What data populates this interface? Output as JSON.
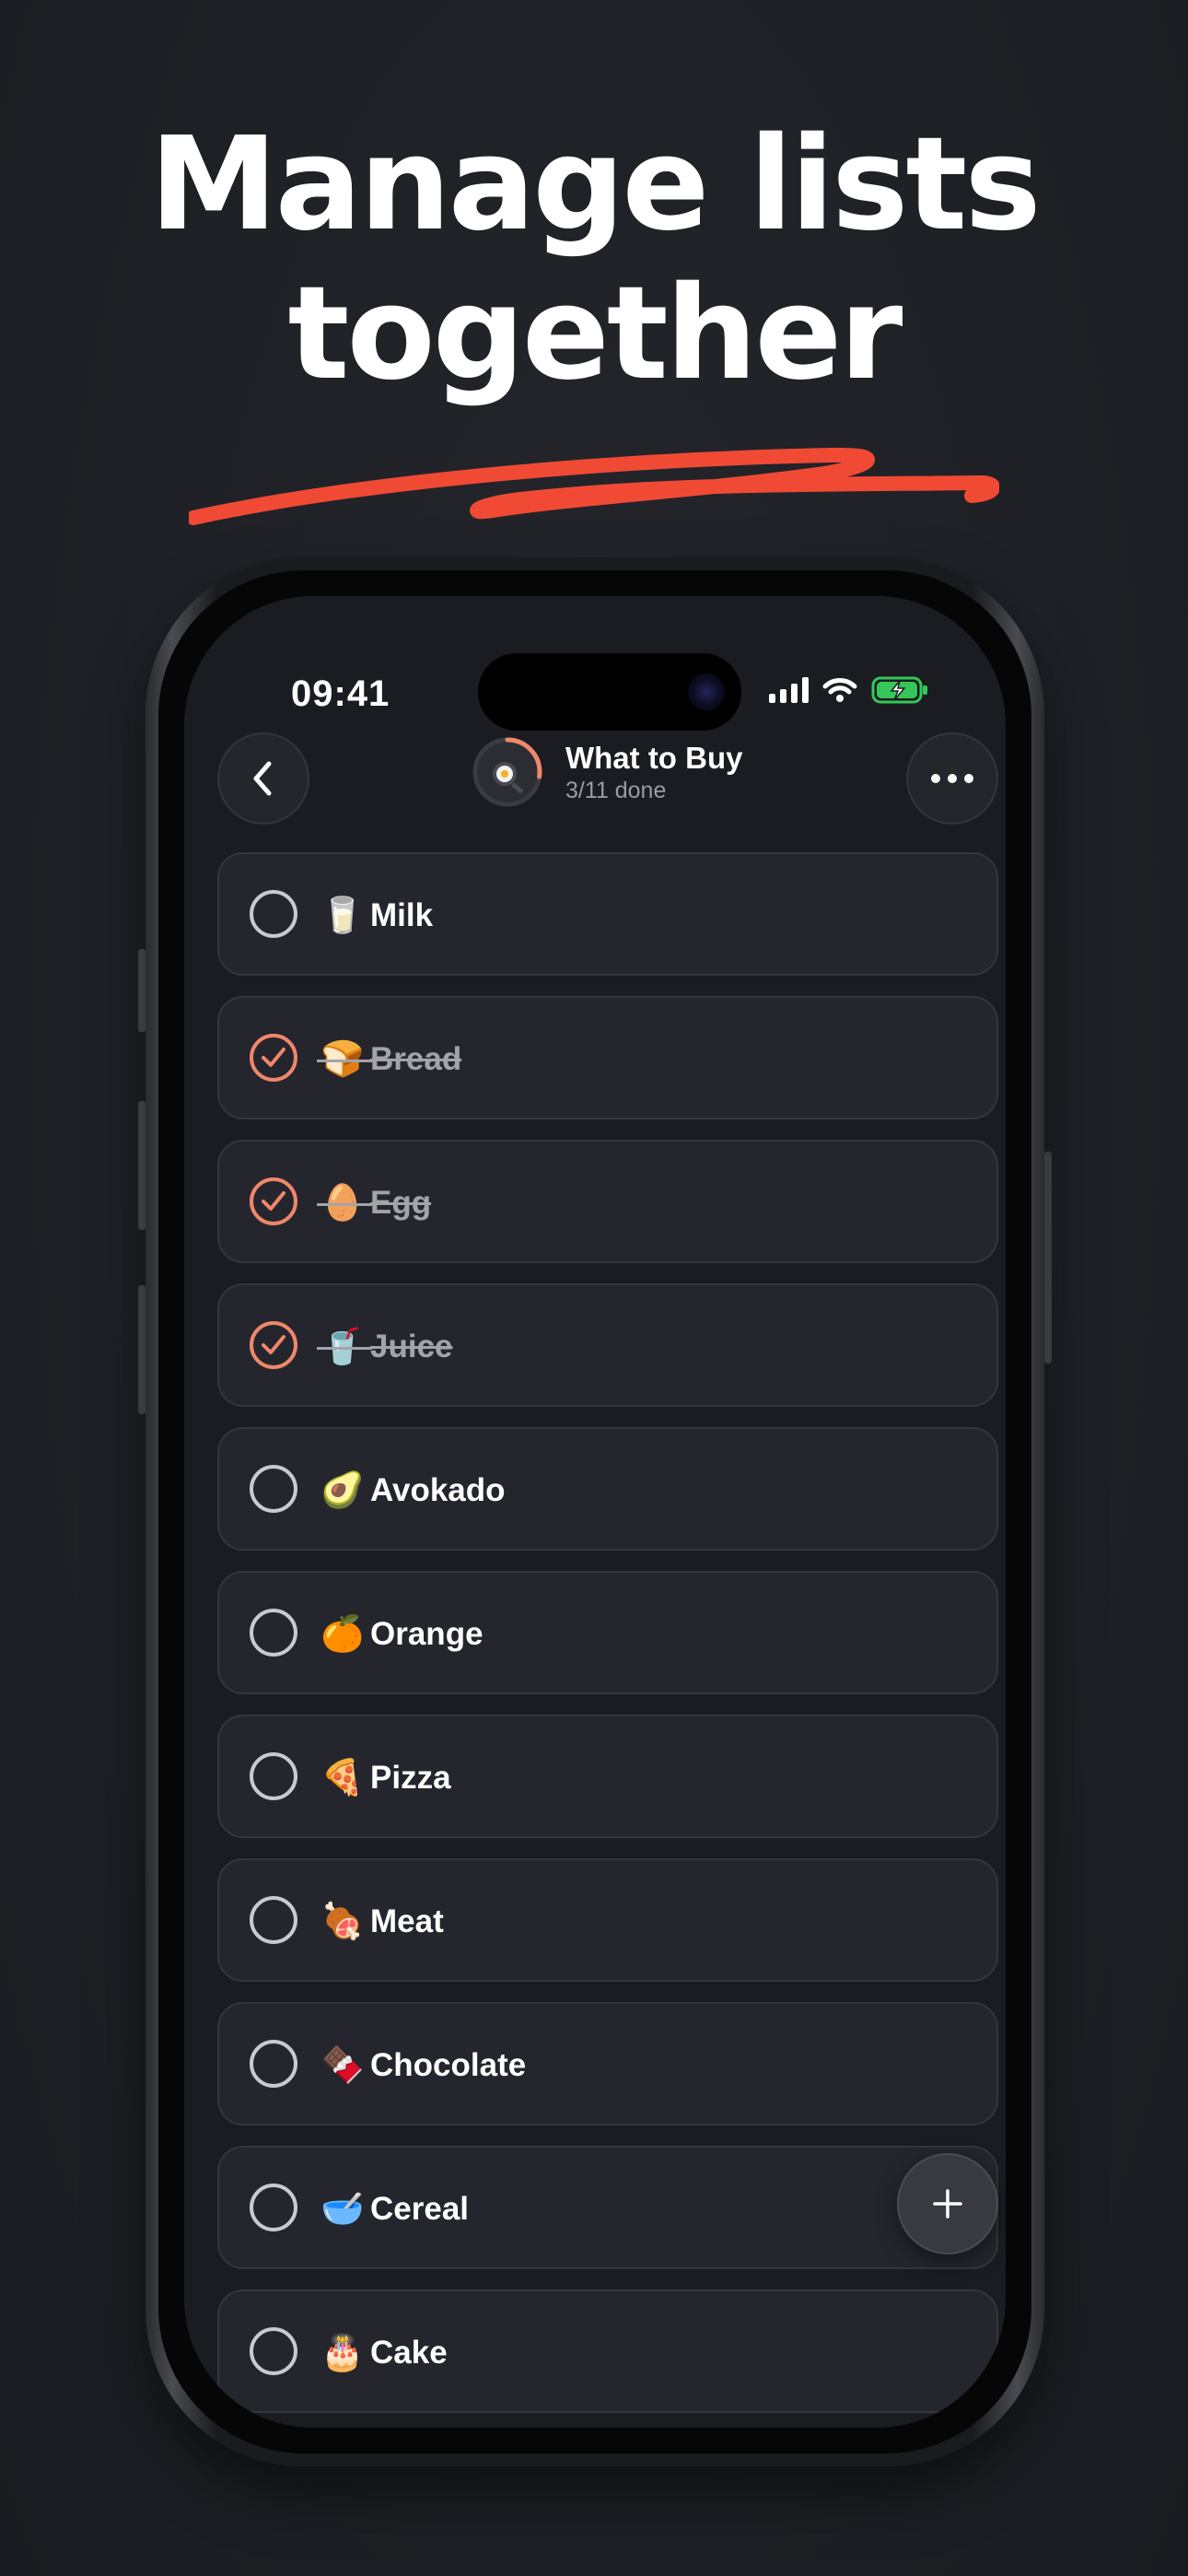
{
  "headline": {
    "line1": "Manage lists",
    "line2": "together"
  },
  "colors": {
    "accent": "#f0876a",
    "swoosh": "#f04a35",
    "card": "#25262d",
    "background": "#1d1f24"
  },
  "status_bar": {
    "time": "09:41",
    "icons": [
      "signal-icon",
      "wifi-icon",
      "battery-charging-icon"
    ]
  },
  "header": {
    "title": "What to Buy",
    "subtitle": "3/11 done",
    "list_icon": "frying-pan-icon",
    "progress": {
      "done": 3,
      "total": 11
    },
    "back_icon": "chevron-left-icon",
    "more_icon": "ellipsis-icon"
  },
  "items": [
    {
      "emoji": "🥛",
      "label": "Milk",
      "done": false
    },
    {
      "emoji": "🍞",
      "label": "Bread",
      "done": true
    },
    {
      "emoji": "🥚",
      "label": "Egg",
      "done": true
    },
    {
      "emoji": "🥤",
      "label": "Juice",
      "done": true
    },
    {
      "emoji": "🥑",
      "label": "Avokado",
      "done": false
    },
    {
      "emoji": "🍊",
      "label": "Orange",
      "done": false
    },
    {
      "emoji": "🍕",
      "label": "Pizza",
      "done": false
    },
    {
      "emoji": "🍖",
      "label": "Meat",
      "done": false
    },
    {
      "emoji": "🍫",
      "label": "Chocolate",
      "done": false
    },
    {
      "emoji": "🥣",
      "label": "Cereal",
      "done": false
    },
    {
      "emoji": "🎂",
      "label": "Cake",
      "done": false
    }
  ],
  "fab": {
    "icon": "plus-icon"
  }
}
